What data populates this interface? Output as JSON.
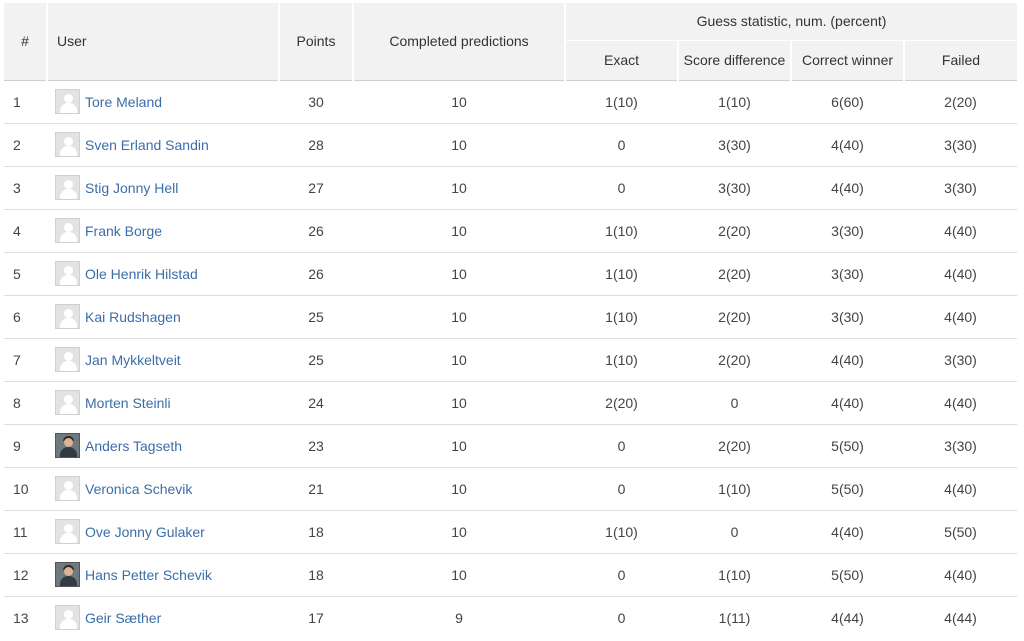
{
  "header": {
    "rank": "#",
    "user": "User",
    "points": "Points",
    "completed": "Completed predictions",
    "group": "Guess statistic, num. (percent)",
    "exact": "Exact",
    "score_difference": "Score difference",
    "correct_winner": "Correct winner",
    "failed": "Failed"
  },
  "rows": [
    {
      "rank": "1",
      "name": "Tore Meland",
      "avatar": "user-placeholder-icon",
      "points": "30",
      "completed": "10",
      "exact": "1(10)",
      "diff": "1(10)",
      "winner": "6(60)",
      "failed": "2(20)"
    },
    {
      "rank": "2",
      "name": "Sven Erland Sandin",
      "avatar": "user-placeholder-icon",
      "points": "28",
      "completed": "10",
      "exact": "0",
      "diff": "3(30)",
      "winner": "4(40)",
      "failed": "3(30)"
    },
    {
      "rank": "3",
      "name": "Stig Jonny Hell",
      "avatar": "user-placeholder-icon",
      "points": "27",
      "completed": "10",
      "exact": "0",
      "diff": "3(30)",
      "winner": "4(40)",
      "failed": "3(30)"
    },
    {
      "rank": "4",
      "name": "Frank Borge",
      "avatar": "user-placeholder-icon",
      "points": "26",
      "completed": "10",
      "exact": "1(10)",
      "diff": "2(20)",
      "winner": "3(30)",
      "failed": "4(40)"
    },
    {
      "rank": "5",
      "name": "Ole Henrik Hilstad",
      "avatar": "user-placeholder-icon",
      "points": "26",
      "completed": "10",
      "exact": "1(10)",
      "diff": "2(20)",
      "winner": "3(30)",
      "failed": "4(40)"
    },
    {
      "rank": "6",
      "name": "Kai Rudshagen",
      "avatar": "user-placeholder-icon",
      "points": "25",
      "completed": "10",
      "exact": "1(10)",
      "diff": "2(20)",
      "winner": "3(30)",
      "failed": "4(40)"
    },
    {
      "rank": "7",
      "name": "Jan Mykkeltveit",
      "avatar": "user-placeholder-icon",
      "points": "25",
      "completed": "10",
      "exact": "1(10)",
      "diff": "2(20)",
      "winner": "4(40)",
      "failed": "3(30)"
    },
    {
      "rank": "8",
      "name": "Morten Steinli",
      "avatar": "user-placeholder-icon",
      "points": "24",
      "completed": "10",
      "exact": "2(20)",
      "diff": "0",
      "winner": "4(40)",
      "failed": "4(40)"
    },
    {
      "rank": "9",
      "name": "Anders Tagseth",
      "avatar": "user-photo",
      "points": "23",
      "completed": "10",
      "exact": "0",
      "diff": "2(20)",
      "winner": "5(50)",
      "failed": "3(30)"
    },
    {
      "rank": "10",
      "name": "Veronica Schevik",
      "avatar": "user-placeholder-icon",
      "points": "21",
      "completed": "10",
      "exact": "0",
      "diff": "1(10)",
      "winner": "5(50)",
      "failed": "4(40)"
    },
    {
      "rank": "11",
      "name": "Ove Jonny Gulaker",
      "avatar": "user-placeholder-icon",
      "points": "18",
      "completed": "10",
      "exact": "1(10)",
      "diff": "0",
      "winner": "4(40)",
      "failed": "5(50)"
    },
    {
      "rank": "12",
      "name": "Hans Petter Schevik",
      "avatar": "user-photo",
      "points": "18",
      "completed": "10",
      "exact": "0",
      "diff": "1(10)",
      "winner": "5(50)",
      "failed": "4(40)"
    },
    {
      "rank": "13",
      "name": "Geir Sæther",
      "avatar": "user-placeholder-icon",
      "points": "17",
      "completed": "9",
      "exact": "0",
      "diff": "1(11)",
      "winner": "4(44)",
      "failed": "4(44)"
    }
  ],
  "colors": {
    "link": "#3b6ea8",
    "header_bg": "#f2f2f2",
    "row_border": "#dddddd"
  }
}
